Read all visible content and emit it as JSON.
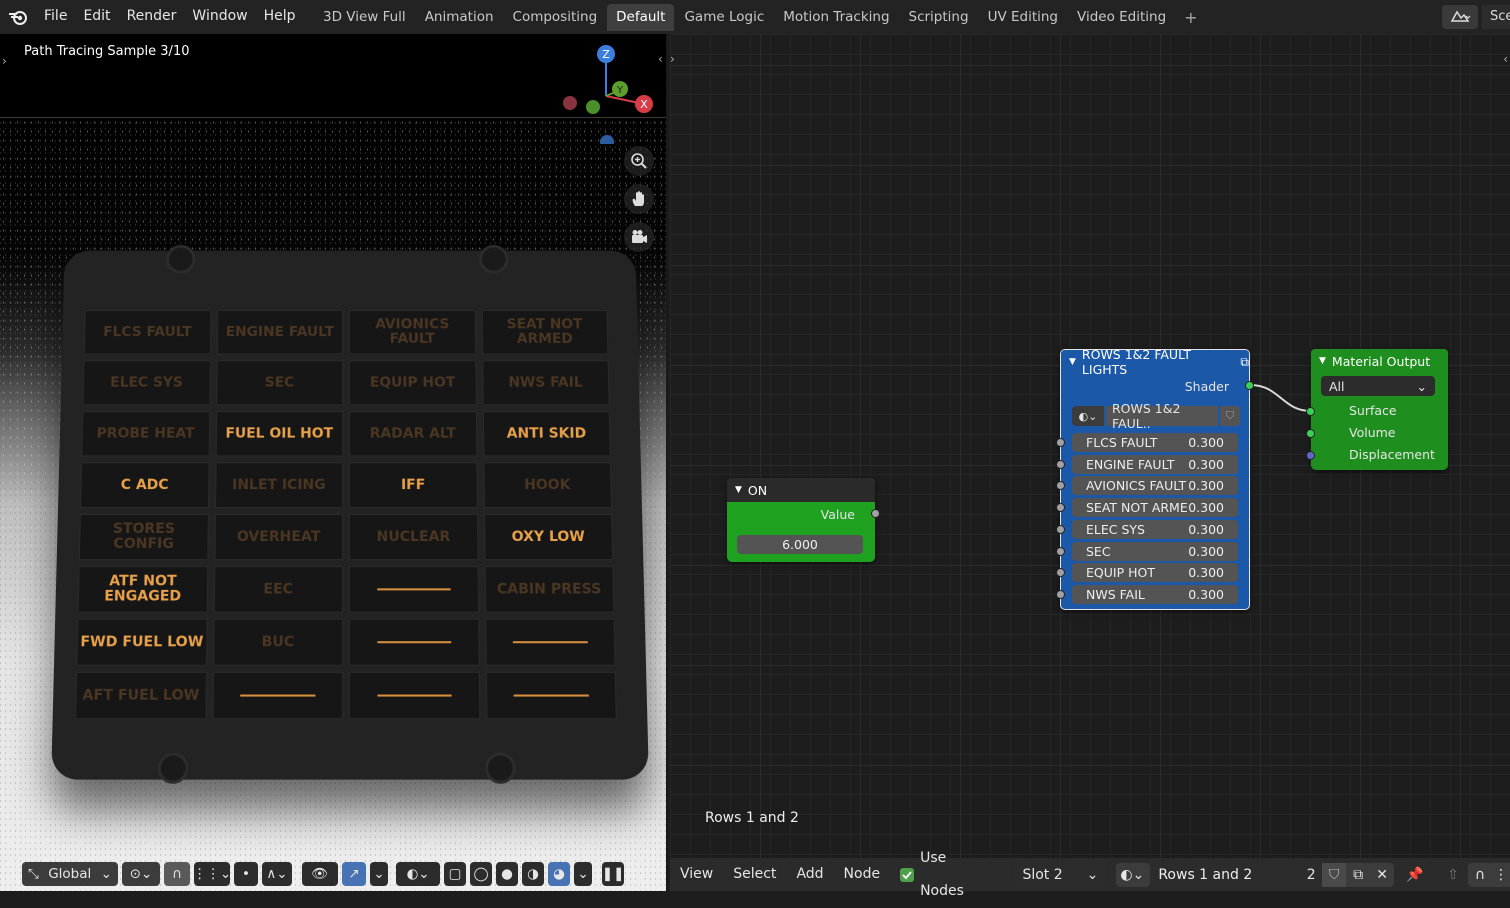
{
  "menu": {
    "items": [
      "File",
      "Edit",
      "Render",
      "Window",
      "Help"
    ]
  },
  "workspaces": {
    "tabs": [
      "3D View Full",
      "Animation",
      "Compositing",
      "Default",
      "Game Logic",
      "Motion Tracking",
      "Scripting",
      "UV Editing",
      "Video Editing"
    ],
    "active": "Default"
  },
  "scene": {
    "name_partial": "Sce"
  },
  "viewport": {
    "status": "Path Tracing Sample 3/10",
    "gizmo_axes": [
      "Z",
      "Y",
      "X"
    ],
    "panel_rows": [
      [
        "FLCS FAULT",
        "ENGINE FAULT",
        "AVIONICS FAULT",
        "SEAT NOT ARMED"
      ],
      [
        "ELEC SYS",
        "SEC",
        "EQUIP HOT",
        "NWS FAIL"
      ],
      [
        "PROBE HEAT",
        "FUEL OIL HOT",
        "RADAR ALT",
        "ANTI SKID"
      ],
      [
        "C ADC",
        "INLET ICING",
        "IFF",
        "HOOK"
      ],
      [
        "STORES CONFIG",
        "OVERHEAT",
        "NUCLEAR",
        "OXY LOW"
      ],
      [
        "ATF NOT ENGAGED",
        "EEC",
        "—",
        "CABIN PRESS"
      ],
      [
        "FWD FUEL LOW",
        "BUC",
        "—",
        "—"
      ],
      [
        "AFT FUEL LOW",
        "—",
        "—",
        "—"
      ]
    ],
    "lit_cells": [
      "FUEL OIL HOT",
      "ANTI SKID",
      "C ADC",
      "IFF",
      "OXY LOW",
      "ATF NOT ENGAGED",
      "FWD FUEL LOW"
    ],
    "footer": {
      "orientation": "Global"
    }
  },
  "node_editor": {
    "label": "Rows 1 and 2",
    "value_node": {
      "title": "ON",
      "output_label": "Value",
      "value": "6.000"
    },
    "group_node": {
      "title": "ROWS 1&2 FAULT LIGHTS",
      "output_label": "Shader",
      "datablock": "ROWS 1&2 FAUL..",
      "inputs": [
        {
          "label": "FLCS FAULT",
          "value": "0.300"
        },
        {
          "label": "ENGINE FAULT",
          "value": "0.300"
        },
        {
          "label": "AVIONICS FAULT",
          "value": "0.300"
        },
        {
          "label": "SEAT NOT ARME",
          "value": "0.300"
        },
        {
          "label": "ELEC SYS",
          "value": "0.300"
        },
        {
          "label": "SEC",
          "value": "0.300"
        },
        {
          "label": "EQUIP HOT",
          "value": "0.300"
        },
        {
          "label": "NWS FAIL",
          "value": "0.300"
        }
      ]
    },
    "output_node": {
      "title": "Material Output",
      "target": "All",
      "inputs": [
        "Surface",
        "Volume",
        "Displacement"
      ]
    },
    "footer": {
      "menus": [
        "View",
        "Select",
        "Add",
        "Node"
      ],
      "use_nodes_label": "Use Nodes",
      "slot": "Slot 2",
      "material": "Rows 1 and 2",
      "users": "2"
    }
  },
  "colors": {
    "accent": "#4772b3",
    "value_node": "#2fa82f",
    "group_node": "#1f57a1",
    "output_node": "#2f8f2f",
    "lit_text": "#e8a04a"
  }
}
